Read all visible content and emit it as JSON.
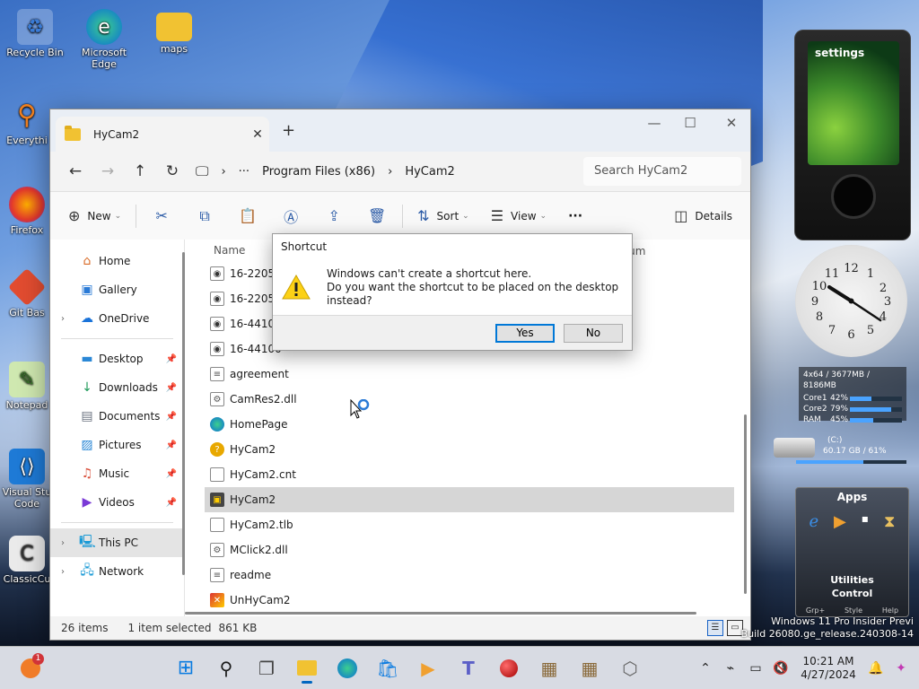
{
  "desktop": {
    "icons": [
      {
        "label": "Recycle Bin"
      },
      {
        "label": "Microsoft Edge"
      },
      {
        "label": "maps"
      },
      {
        "label": "Everythi"
      },
      {
        "label": "Firefox"
      },
      {
        "label": "Git Bas"
      },
      {
        "label": "Notepad"
      },
      {
        "label": "Visual Stu Code"
      },
      {
        "label": "ClassicCu"
      }
    ]
  },
  "explorer": {
    "tab_title": "HyCam2",
    "new_tab": "+",
    "window_controls": {
      "minimize": "—",
      "maximize": "☐",
      "close": "✕"
    },
    "breadcrumb": [
      "Program Files (x86)",
      "HyCam2"
    ],
    "breadcrumb_more": "···",
    "search_placeholder": "Search HyCam2",
    "toolbar": {
      "new": "New",
      "sort": "Sort",
      "view": "View",
      "more": "···",
      "details": "Details"
    },
    "nav": {
      "home": "Home",
      "gallery": "Gallery",
      "onedrive": "OneDrive",
      "desktop": "Desktop",
      "downloads": "Downloads",
      "documents": "Documents",
      "pictures": "Pictures",
      "music": "Music",
      "videos": "Videos",
      "thispc": "This PC",
      "network": "Network"
    },
    "columns": {
      "name": "Name",
      "album": "Album"
    },
    "files": [
      {
        "name": "16-22050",
        "type": "audio"
      },
      {
        "name": "16-22050",
        "type": "audio"
      },
      {
        "name": "16-44100",
        "type": "audio"
      },
      {
        "name": "16-44100",
        "type": "audio"
      },
      {
        "name": "agreement",
        "type": "text"
      },
      {
        "name": "CamRes2.dll",
        "type": "dll"
      },
      {
        "name": "HomePage",
        "type": "web"
      },
      {
        "name": "HyCam2",
        "type": "help"
      },
      {
        "name": "HyCam2.cnt",
        "type": "file"
      },
      {
        "name": "HyCam2",
        "type": "app",
        "selected": true
      },
      {
        "name": "HyCam2.tlb",
        "type": "file"
      },
      {
        "name": "MClick2.dll",
        "type": "dll"
      },
      {
        "name": "readme",
        "type": "text"
      },
      {
        "name": "UnHyCam2",
        "type": "app2"
      }
    ],
    "status": {
      "count": "26 items",
      "selected": "1 item selected",
      "size": "861 KB"
    }
  },
  "dialog": {
    "title": "Shortcut",
    "line1": "Windows can't create a shortcut here.",
    "line2": "Do you want the shortcut to be placed on the desktop instead?",
    "yes": "Yes",
    "no": "No"
  },
  "gadgets": {
    "zune_title": "settings",
    "meter_header": "4x64 / 3677MB / 8186MB",
    "meter_rows": [
      {
        "label": "Core1",
        "pct": "42%",
        "value": 0.42
      },
      {
        "label": "Core2",
        "pct": "79%",
        "value": 0.79
      },
      {
        "label": "RAM",
        "pct": "45%",
        "value": 0.45
      }
    ],
    "drive_label": "(C:)",
    "drive_info": "60.17 GB / 61%",
    "apps_title": "Apps",
    "apps_utilities": "Utilities",
    "apps_control": "Control",
    "apps_foot": [
      "Grp+",
      "Style",
      "Help"
    ]
  },
  "watermark": {
    "line1": "Windows 11 Pro Insider Previ",
    "line2": "Build 26080.ge_release.240308-14"
  },
  "taskbar": {
    "time": "10:21 AM",
    "date": "4/27/2024",
    "badge": "1"
  }
}
